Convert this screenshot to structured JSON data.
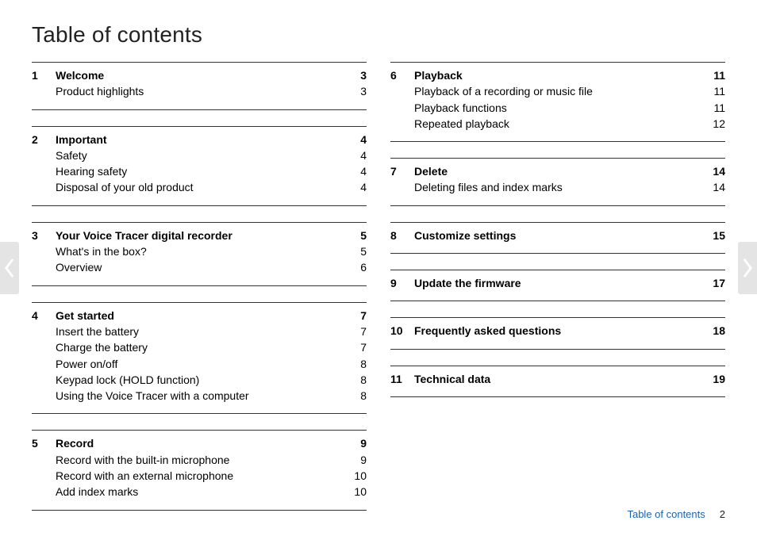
{
  "title": "Table of contents",
  "footer": {
    "label": "Table of contents",
    "page": "2"
  },
  "left_sections": [
    {
      "num": "1",
      "title": "Welcome",
      "page": "3",
      "items": [
        {
          "label": "Product highlights",
          "page": "3"
        }
      ]
    },
    {
      "num": "2",
      "title": "Important",
      "page": "4",
      "items": [
        {
          "label": "Safety",
          "page": "4"
        },
        {
          "label": "Hearing safety",
          "page": "4"
        },
        {
          "label": "Disposal of your old product",
          "page": "4"
        }
      ]
    },
    {
      "num": "3",
      "title": "Your Voice Tracer digital recorder",
      "page": "5",
      "items": [
        {
          "label": "What's in the box?",
          "page": "5"
        },
        {
          "label": "Overview",
          "page": "6"
        }
      ]
    },
    {
      "num": "4",
      "title": "Get started",
      "page": "7",
      "items": [
        {
          "label": "Insert the battery",
          "page": "7"
        },
        {
          "label": "Charge the battery",
          "page": "7"
        },
        {
          "label": "Power on/off",
          "page": "8"
        },
        {
          "label": "Keypad lock (HOLD function)",
          "page": "8"
        },
        {
          "label": "Using the Voice Tracer with a computer",
          "page": "8"
        }
      ]
    },
    {
      "num": "5",
      "title": "Record",
      "page": "9",
      "items": [
        {
          "label": "Record with the built-in microphone",
          "page": "9"
        },
        {
          "label": "Record with an external microphone",
          "page": "10"
        },
        {
          "label": "Add index marks",
          "page": "10"
        }
      ]
    }
  ],
  "right_sections": [
    {
      "num": "6",
      "title": "Playback",
      "page": "11",
      "items": [
        {
          "label": "Playback of a recording or music file",
          "page": "11"
        },
        {
          "label": "Playback functions",
          "page": "11"
        },
        {
          "label": "Repeated playback",
          "page": "12"
        }
      ]
    },
    {
      "num": "7",
      "title": "Delete",
      "page": "14",
      "items": [
        {
          "label": "Deleting files and index marks",
          "page": "14"
        }
      ]
    },
    {
      "num": "8",
      "title": "Customize settings",
      "page": "15",
      "items": []
    },
    {
      "num": "9",
      "title": "Update the firmware",
      "page": "17",
      "items": []
    },
    {
      "num": "10",
      "title": "Frequently asked questions",
      "page": "18",
      "items": []
    },
    {
      "num": "11",
      "title": "Technical data",
      "page": "19",
      "items": []
    }
  ]
}
